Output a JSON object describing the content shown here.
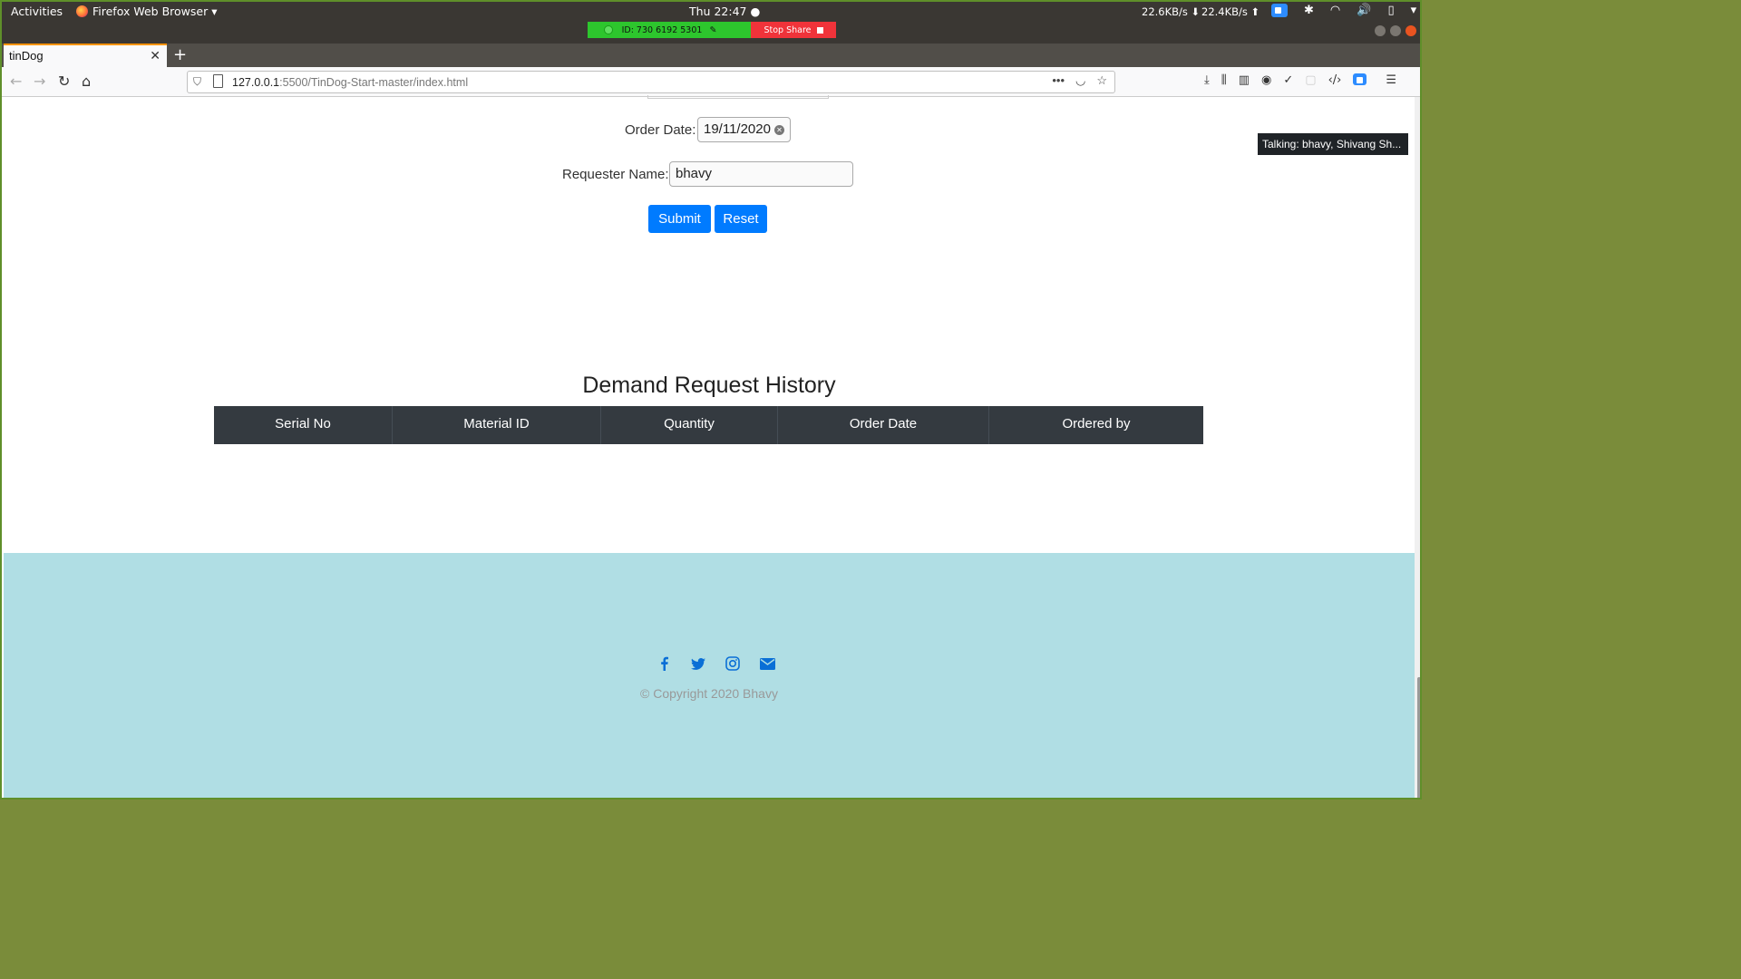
{
  "system": {
    "activities": "Activities",
    "app_menu": "Firefox Web Browser ▾",
    "clock": "Thu 22:47 ●",
    "net_down": "22.6KB/s ⬇",
    "net_up": "22.4KB/s ⬆"
  },
  "share": {
    "meeting_id": "ID: 730 6192 5301",
    "stop_label": "Stop Share"
  },
  "browser": {
    "tab_title": "tinDog",
    "tab_close": "✕",
    "new_tab": "+",
    "url_host": "127.0.0.1",
    "url_rest": ":5500/TinDog-Start-master/index.html"
  },
  "form": {
    "order_date_label": "Order Date:",
    "order_date_value": "19/11/2020",
    "requester_label": "Requester Name:",
    "requester_value": "bhavy",
    "submit_label": "Submit",
    "reset_label": "Reset"
  },
  "history": {
    "title": "Demand Request History",
    "columns": [
      "Serial No",
      "Material ID",
      "Quantity",
      "Order Date",
      "Ordered by"
    ]
  },
  "footer": {
    "copyright": "© Copyright 2020 Bhavy",
    "icons": [
      "facebook-icon",
      "twitter-icon",
      "instagram-icon",
      "mail-icon"
    ]
  },
  "zoom_tooltip": "Talking: bhavy, Shivang Sh...",
  "colors": {
    "primary_button": "#007bff",
    "table_header": "#343a40",
    "footer_bg": "#b0dee4",
    "stop_share": "#f0333a",
    "share_green": "#2dc62d"
  }
}
